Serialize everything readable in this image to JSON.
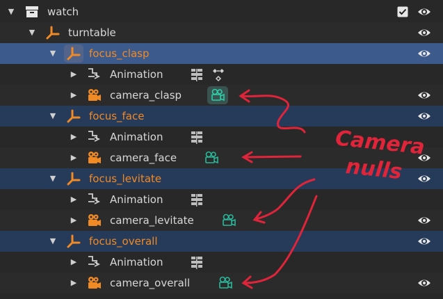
{
  "outliner": {
    "rows": [
      {
        "label": "watch",
        "type": "collection"
      },
      {
        "label": "turntable",
        "type": "empty"
      },
      {
        "label": "focus_clasp",
        "type": "empty"
      },
      {
        "label": "Animation",
        "type": "animation"
      },
      {
        "label": "camera_clasp",
        "type": "camera"
      },
      {
        "label": "focus_face",
        "type": "empty"
      },
      {
        "label": "Animation",
        "type": "animation"
      },
      {
        "label": "camera_face",
        "type": "camera"
      },
      {
        "label": "focus_levitate",
        "type": "empty"
      },
      {
        "label": "Animation",
        "type": "animation"
      },
      {
        "label": "camera_levitate",
        "type": "camera"
      },
      {
        "label": "focus_overall",
        "type": "empty"
      },
      {
        "label": "Animation",
        "type": "animation"
      },
      {
        "label": "camera_overall",
        "type": "camera"
      }
    ]
  },
  "annotation": {
    "line1": "Camera",
    "line2": "nulls"
  },
  "colors": {
    "accent_orange": "#f08a24",
    "camera_green": "#2bb89a",
    "annotation_red": "#e0243a",
    "selection_blue": "#324a70"
  }
}
